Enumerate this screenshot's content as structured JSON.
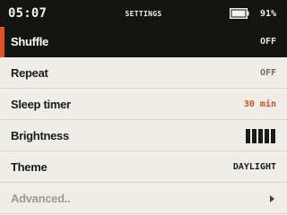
{
  "status": {
    "time": "05:07",
    "title": "SETTINGS",
    "battery_percent": "91%",
    "battery_level": 0.91
  },
  "colors": {
    "accent": "#e0521f",
    "selected_bg": "#141510",
    "background": "#efede8"
  },
  "menu": [
    {
      "label": "Shuffle",
      "value": "OFF",
      "selected": true
    },
    {
      "label": "Repeat",
      "value": "OFF"
    },
    {
      "label": "Sleep timer",
      "value": "30 min"
    },
    {
      "label": "Brightness",
      "icon": "brightness-level-bars",
      "level": 5,
      "max": 5
    },
    {
      "label": "Theme",
      "value": "DAYLIGHT"
    },
    {
      "label": "Advanced..",
      "icon": "chevron-right-icon",
      "disabled": true
    }
  ]
}
